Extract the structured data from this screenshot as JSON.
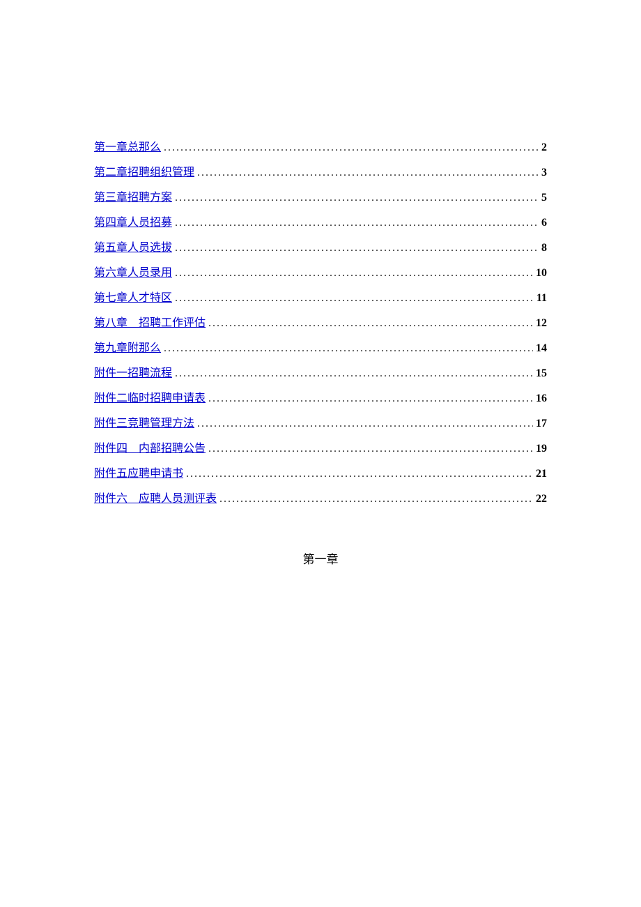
{
  "toc": {
    "entries": [
      {
        "title": "第一章总那么",
        "page": "2"
      },
      {
        "title": "第二章招聘组织管理",
        "page": "3"
      },
      {
        "title": "第三章招聘方案",
        "page": "5"
      },
      {
        "title": "第四章人员招募",
        "page": "6"
      },
      {
        "title": "第五章人员选拔",
        "page": "8"
      },
      {
        "title": "第六章人员录用",
        "page": "10"
      },
      {
        "title": "第七章人才特区",
        "page": "11"
      },
      {
        "title": "第八章　招聘工作评估",
        "page": "12"
      },
      {
        "title": "第九章附那么",
        "page": "14"
      },
      {
        "title": "附件一招聘流程",
        "page": "15"
      },
      {
        "title": "附件二临时招聘申请表",
        "page": "16"
      },
      {
        "title": "附件三竞聘管理方法",
        "page": "17"
      },
      {
        "title": "附件四　内部招聘公告",
        "page": "19"
      },
      {
        "title": "附件五应聘申请书",
        "page": "21"
      },
      {
        "title": "附件六　应聘人员测评表",
        "page": "22"
      }
    ]
  },
  "chapter_heading": "第一章"
}
